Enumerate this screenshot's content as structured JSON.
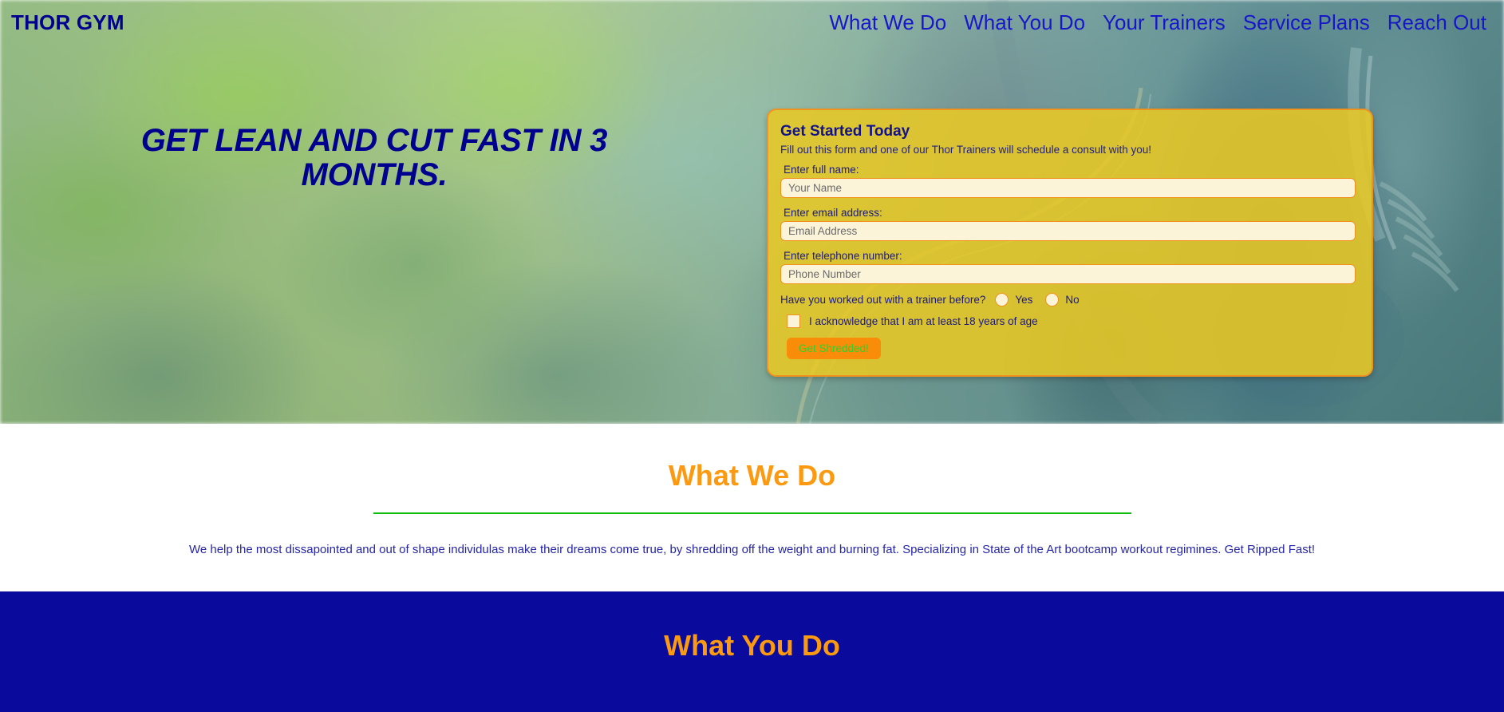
{
  "brand": {
    "logo": "THOR GYM",
    "navy": "#00008f",
    "orange": "#fb9a10",
    "green": "#0bbc0b",
    "gold": "#e8c824"
  },
  "nav": {
    "items": [
      {
        "label": "What We Do"
      },
      {
        "label": "What You Do"
      },
      {
        "label": "Your Trainers"
      },
      {
        "label": "Service Plans"
      },
      {
        "label": "Reach Out"
      }
    ]
  },
  "hero": {
    "headline": "GET LEAN AND CUT FAST IN 3 MONTHS."
  },
  "form": {
    "title": "Get Started Today",
    "subtitle": "Fill out this form and one of our Thor Trainers will schedule a consult with you!",
    "name_label": "Enter full name:",
    "name_placeholder": "Your Name",
    "name_value": "",
    "email_label": "Enter email address:",
    "email_placeholder": "Email Address",
    "email_value": "",
    "phone_label": "Enter telephone number:",
    "phone_placeholder": "Phone Number",
    "phone_value": "",
    "radio_question": "Have you worked out with a trainer before?",
    "radio_yes": "Yes",
    "radio_no": "No",
    "checkbox_label": "I acknowledge that I am at least 18 years of age",
    "submit_label": "Get Shredded!"
  },
  "section_what_we_do": {
    "heading": "What We Do",
    "paragraph": "We help the most dissapointed and out of shape individulas make their dreams come true, by shredding off the weight and burning fat. Specializing in State of the Art bootcamp workout regimines. Get Ripped Fast!"
  },
  "section_what_you_do": {
    "heading": "What You Do"
  }
}
